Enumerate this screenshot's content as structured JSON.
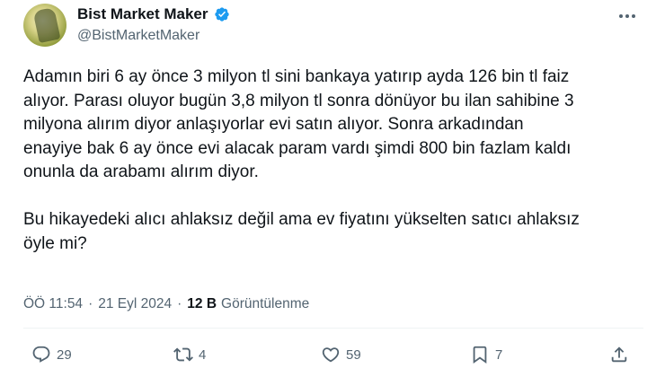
{
  "author": {
    "display_name": "Bist Market Maker",
    "handle": "@BistMarketMaker"
  },
  "tweet": {
    "text": "Adamın biri 6 ay önce 3 milyon tl sini bankaya yatırıp ayda 126 bin tl faiz\nalıyor. Parası oluyor bugün 3,8 milyon tl sonra dönüyor bu ilan sahibine 3\nmilyona alırım diyor anlaşıyorlar evi satın alıyor. Sonra arkadından\nenayiye bak 6 ay önce evi alacak param vardı şimdi 800 bin fazlam kaldı\nonunla da arabamı alırım diyor.\n\nBu hikayedeki alıcı ahlaksız değil ama ev fiyatını yükselten satıcı ahlaksız\nöyle mi?"
  },
  "meta": {
    "time": "ÖÖ 11:54",
    "separator": "·",
    "date": "21 Eyl 2024",
    "views_count": "12 B",
    "views_label": "Görüntülenme"
  },
  "actions": {
    "replies": "29",
    "reposts": "4",
    "likes": "59",
    "bookmarks": "7"
  },
  "colors": {
    "text": "#0f1419",
    "secondary": "#536471",
    "verified": "#1d9bf0",
    "divider": "#eff3f4"
  }
}
